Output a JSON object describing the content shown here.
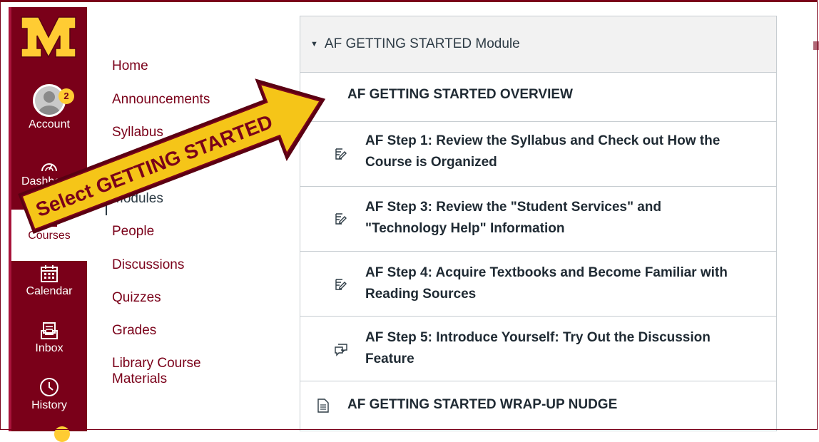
{
  "global_nav": {
    "account": {
      "label": "Account",
      "badge": "2"
    },
    "dashboard": {
      "label": "Dashboard"
    },
    "courses": {
      "label": "Courses"
    },
    "calendar": {
      "label": "Calendar"
    },
    "inbox": {
      "label": "Inbox"
    },
    "history": {
      "label": "History"
    }
  },
  "course_nav": {
    "items": [
      "Home",
      "Announcements",
      "Syllabus",
      "Modules",
      "People",
      "Discussions",
      "Quizzes",
      "Grades",
      "Library Course",
      "Materials"
    ],
    "active": "Modules"
  },
  "module": {
    "title": "AF GETTING STARTED Module",
    "items": [
      {
        "line1": "AF GETTING STARTED OVERVIEW",
        "line2": "",
        "icon": "page-icon"
      },
      {
        "line1": "AF Step 1: Review the Syllabus and Check out How the",
        "line2": "Course is Organized",
        "icon": "assignment-icon"
      },
      {
        "line1": "AF Step 3: Review the \"Student Services\" and",
        "line2": "\"Technology Help\" Information",
        "icon": "assignment-icon"
      },
      {
        "line1": "AF Step 4: Acquire Textbooks and Become Familiar with",
        "line2": "Reading Sources",
        "icon": "assignment-icon"
      },
      {
        "line1": "AF Step 5: Introduce Yourself: Try Out the Discussion",
        "line2": "Feature",
        "icon": "discussion-icon"
      },
      {
        "line1": "AF GETTING STARTED WRAP-UP NUDGE",
        "line2": "",
        "icon": "page-icon"
      }
    ]
  },
  "callout": {
    "text": "Select GETTING STARTED"
  },
  "colors": {
    "brand": "#7a0019",
    "gold": "#ffcc33",
    "arrow_fill": "#f5c518"
  }
}
